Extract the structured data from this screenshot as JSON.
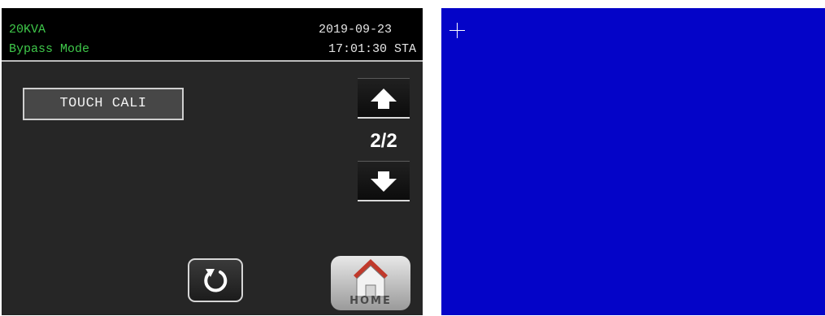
{
  "header": {
    "model": "20KVA",
    "mode": "Bypass Mode",
    "date": "2019-09-23",
    "time": "17:01:30 STA"
  },
  "menu": {
    "touch_cali_label": "TOUCH CALI"
  },
  "pager": {
    "indicator": "2/2",
    "up_icon": "arrow-up-icon",
    "down_icon": "arrow-down-icon"
  },
  "footer": {
    "back_icon": "refresh-back-icon",
    "home_label": "HOME",
    "home_icon": "house-icon"
  },
  "calibration": {
    "marker_icon": "crosshair-icon"
  },
  "colors": {
    "status_green": "#3fc84a",
    "panel_bg": "#262626",
    "calibration_bg": "#0404c8"
  }
}
